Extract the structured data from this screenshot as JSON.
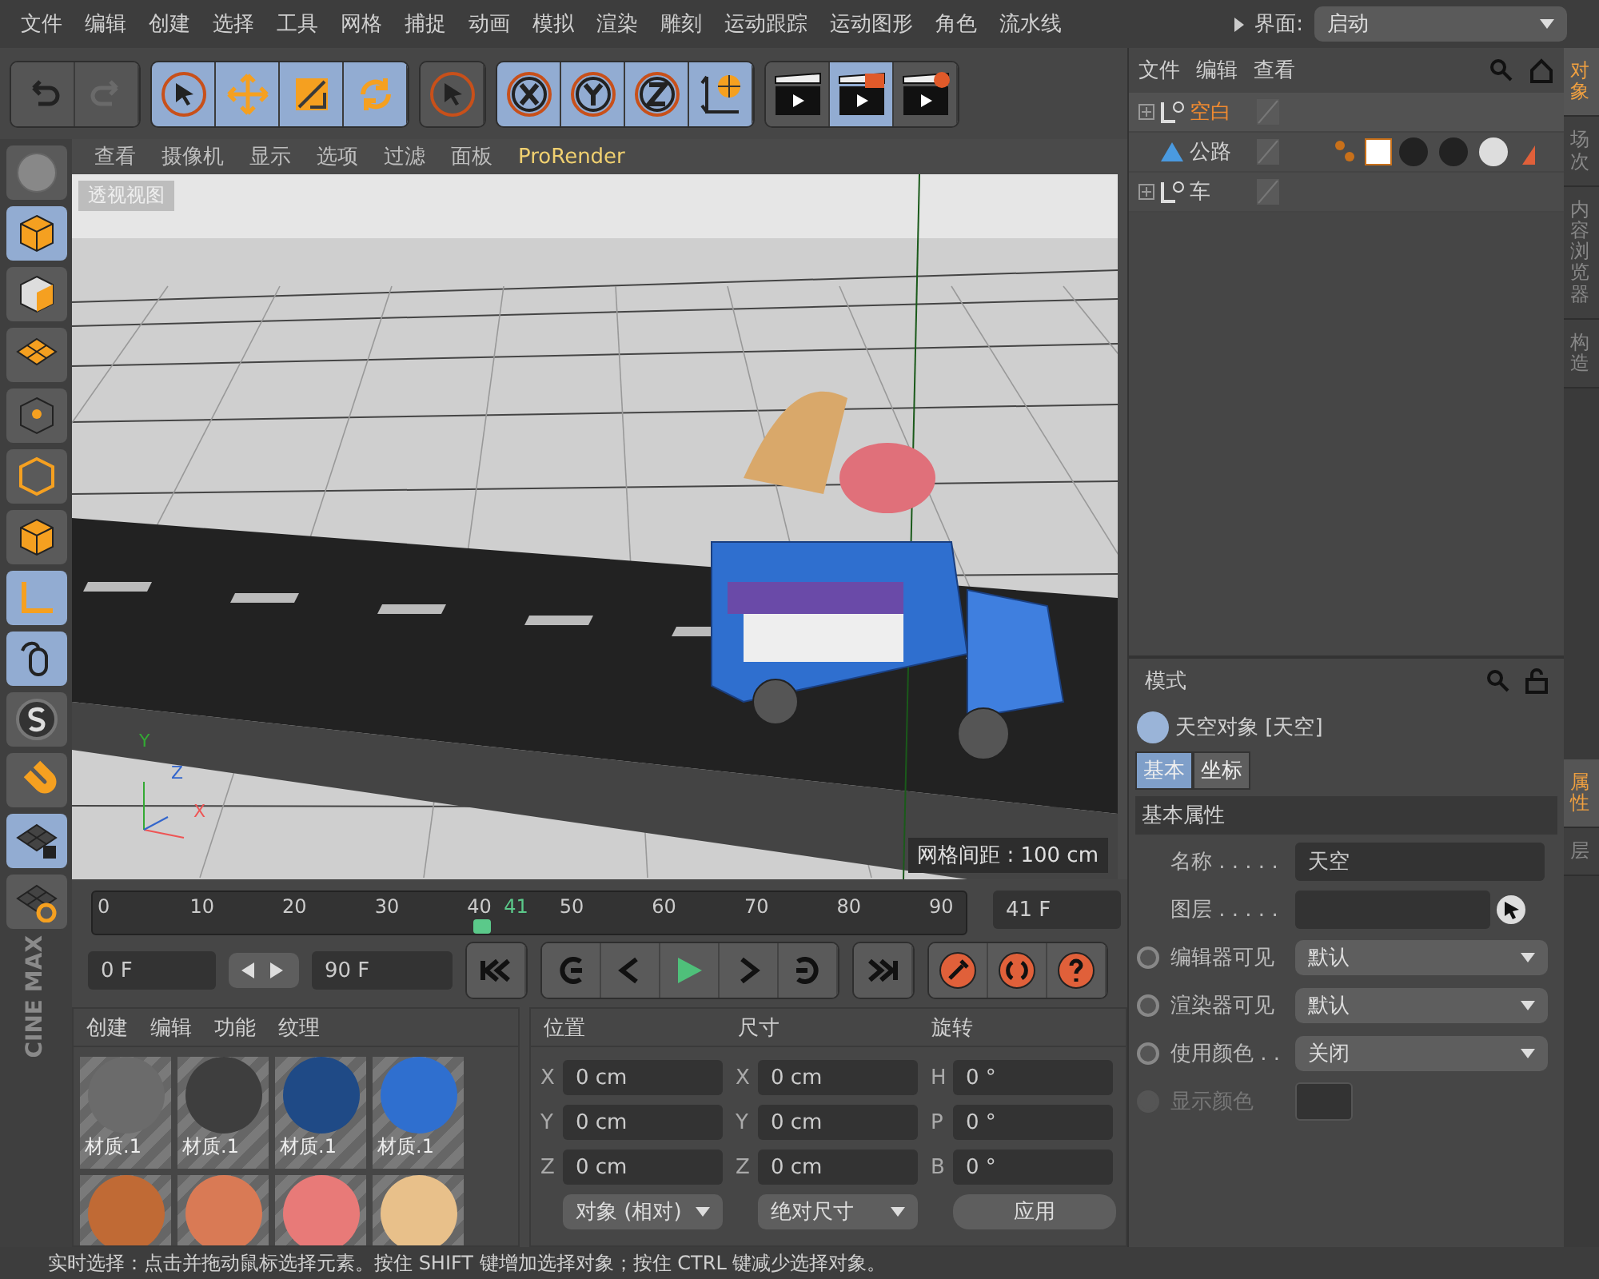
{
  "menu": {
    "items": [
      "文件",
      "编辑",
      "创建",
      "选择",
      "工具",
      "网格",
      "捕捉",
      "动画",
      "模拟",
      "渲染",
      "雕刻",
      "运动跟踪",
      "运动图形",
      "角色",
      "流水线"
    ],
    "interface_label": "界面:",
    "interface_value": "启动"
  },
  "toolbar": [
    [
      {
        "kind": "undo",
        "active": false
      },
      {
        "kind": "redo",
        "active": false
      }
    ],
    [
      {
        "kind": "select",
        "active": true
      },
      {
        "kind": "move",
        "active": true
      },
      {
        "kind": "scale",
        "active": true
      },
      {
        "kind": "rotate",
        "active": true
      }
    ],
    [
      {
        "kind": "live",
        "active": false
      }
    ],
    [
      {
        "kind": "x",
        "active": true
      },
      {
        "kind": "y",
        "active": true
      },
      {
        "kind": "z",
        "active": true
      },
      {
        "kind": "world",
        "active": true
      }
    ],
    [
      {
        "kind": "render",
        "active": false
      },
      {
        "kind": "viewer",
        "active": true
      },
      {
        "kind": "settings",
        "active": false
      }
    ]
  ],
  "tools": [
    {
      "kind": "sphere",
      "active": false
    },
    {
      "kind": "cube",
      "active": true
    },
    {
      "kind": "checker",
      "active": false
    },
    {
      "kind": "plane",
      "active": false
    },
    {
      "kind": "points",
      "active": false
    },
    {
      "kind": "edges",
      "active": false
    },
    {
      "kind": "cube",
      "active": false
    },
    {
      "kind": "axis",
      "active": true
    },
    {
      "kind": "mouse",
      "active": true
    },
    {
      "kind": "snap",
      "active": false
    },
    {
      "kind": "magnet",
      "active": false
    },
    {
      "kind": "lock",
      "active": true
    },
    {
      "kind": "workplane",
      "active": false
    }
  ],
  "logo": [
    "MAX",
    "CINE"
  ],
  "viewport": {
    "menu": [
      {
        "label": "查看",
        "kind": "menu"
      },
      {
        "label": "摄像机",
        "kind": "menu"
      },
      {
        "label": "显示",
        "kind": "menu"
      },
      {
        "label": "选项",
        "kind": "menu"
      },
      {
        "label": "过滤",
        "kind": "menu"
      },
      {
        "label": "面板",
        "kind": "menu"
      },
      {
        "label": "ProRender",
        "kind": "plugin"
      }
    ],
    "view_name": "透视视图",
    "grid_spacing": "网格间距 : 100 cm",
    "axes": [
      "Y",
      "Z",
      "X"
    ]
  },
  "timeline": {
    "ticks": [
      "0",
      "10",
      "20",
      "30",
      "40",
      "50",
      "60",
      "70",
      "80",
      "90"
    ],
    "current": "41",
    "level": 0.456,
    "frame_field": "41 F",
    "start": "0 F",
    "end": "90 F"
  },
  "materials": {
    "tabs": [
      "创建",
      "编辑",
      "功能",
      "纹理"
    ],
    "items": [
      {
        "label": "材质.1",
        "color": "#6b6b6b"
      },
      {
        "label": "材质.1",
        "color": "#3e3e3e"
      },
      {
        "label": "材质.1",
        "color": "#1f4a86"
      },
      {
        "label": "材质.1",
        "color": "#2f6fcf"
      },
      {
        "color": "#c06a35"
      },
      {
        "color": "#d97a55"
      },
      {
        "color": "#e87a78"
      },
      {
        "color": "#e8c08a"
      }
    ]
  },
  "coordinates": {
    "headers": [
      "位置",
      "尺寸",
      "旋转"
    ],
    "rows": [
      [
        {
          "axis": "X",
          "value": "0 cm"
        },
        {
          "axis": "X",
          "value": "0 cm"
        },
        {
          "axis": "H",
          "value": "0 °"
        }
      ],
      [
        {
          "axis": "Y",
          "value": "0 cm"
        },
        {
          "axis": "Y",
          "value": "0 cm"
        },
        {
          "axis": "P",
          "value": "0 °"
        }
      ],
      [
        {
          "axis": "Z",
          "value": "0 cm"
        },
        {
          "axis": "Z",
          "value": "0 cm"
        },
        {
          "axis": "B",
          "value": "0 °"
        }
      ]
    ],
    "mode": "对象 (相对)",
    "size_mode": "绝对尺寸",
    "apply": "应用"
  },
  "objects": {
    "menu": [
      "文件",
      "编辑",
      "查看"
    ],
    "items": [
      {
        "name": "空白",
        "kind": "null",
        "selected": true,
        "expandable": true
      },
      {
        "name": "公路",
        "kind": "polygon",
        "selected": false,
        "expandable": false
      },
      {
        "name": "车",
        "kind": "null",
        "selected": false,
        "expandable": true
      }
    ]
  },
  "side_tabs": [
    {
      "label": "对象",
      "selected": true
    },
    {
      "label": "场次",
      "selected": false
    },
    {
      "label": "内容浏览器",
      "selected": false
    },
    {
      "label": "构造",
      "selected": false
    }
  ],
  "side_tabs_lower": [
    {
      "label": "属性",
      "selected": true
    },
    {
      "label": "层",
      "selected": false
    }
  ],
  "attributes": {
    "menu": "模式",
    "title": "天空对象 [天空]",
    "tabs": [
      {
        "label": "基本",
        "selected": true
      },
      {
        "label": "坐标",
        "selected": false
      }
    ],
    "section": "基本属性",
    "rows": [
      {
        "kind": "text",
        "label": "名称 . . . . .",
        "value": "天空",
        "disabled": false
      },
      {
        "kind": "link",
        "label": "图层 . . . . .",
        "disabled": false
      },
      {
        "kind": "select",
        "label": "编辑器可见",
        "value": "默认",
        "disabled": false
      },
      {
        "kind": "select",
        "label": "渲染器可见",
        "value": "默认",
        "disabled": false
      },
      {
        "kind": "select",
        "label": "使用颜色 . .",
        "value": "关闭",
        "disabled": false
      },
      {
        "kind": "color",
        "label": "显示颜色",
        "disabled": true
      }
    ]
  },
  "status": "实时选择：点击并拖动鼠标选择元素。按住 SHIFT 键增加选择对象；按住 CTRL 键减少选择对象。"
}
